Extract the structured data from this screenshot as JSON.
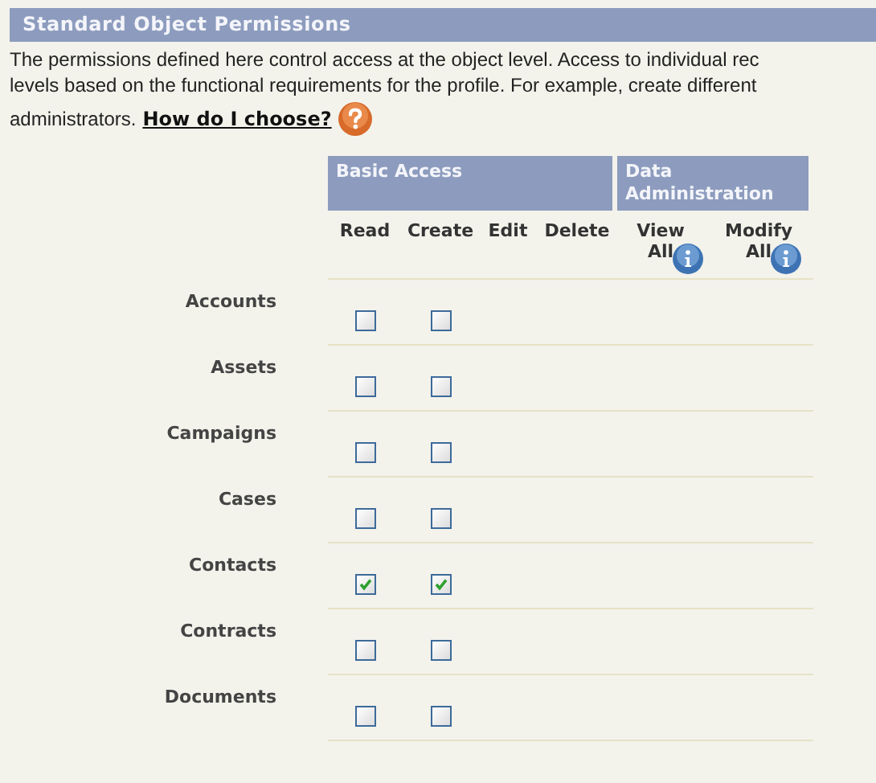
{
  "section": {
    "title": "Standard Object Permissions"
  },
  "intro": {
    "lines": [
      "The permissions defined here control access at the object level. Access to individual rec",
      "levels based on the functional requirements for the profile. For example, create different"
    ],
    "last_line": "administrators.",
    "link": "How do I choose?"
  },
  "groups": [
    {
      "label": "Basic Access",
      "columns": [
        {
          "label": "Read",
          "kind": "plain"
        },
        {
          "label": "Create",
          "kind": "plain"
        },
        {
          "label": "Edit",
          "kind": "plain"
        },
        {
          "label": "Delete",
          "kind": "plain"
        }
      ]
    },
    {
      "label": "Data Administration",
      "columns": [
        {
          "label": "View All",
          "kind": "info"
        },
        {
          "label": "Modify All",
          "kind": "info"
        }
      ]
    }
  ],
  "rows": [
    {
      "name": "Accounts",
      "checkboxes": [
        {
          "checked": false
        },
        {
          "checked": false
        }
      ]
    },
    {
      "name": "Assets",
      "checkboxes": [
        {
          "checked": false
        },
        {
          "checked": false
        }
      ]
    },
    {
      "name": "Campaigns",
      "checkboxes": [
        {
          "checked": false
        },
        {
          "checked": false
        }
      ]
    },
    {
      "name": "Cases",
      "checkboxes": [
        {
          "checked": false
        },
        {
          "checked": false
        }
      ]
    },
    {
      "name": "Contacts",
      "checkboxes": [
        {
          "checked": true
        },
        {
          "checked": true
        }
      ]
    },
    {
      "name": "Contracts",
      "checkboxes": [
        {
          "checked": false
        },
        {
          "checked": false
        }
      ]
    },
    {
      "name": "Documents",
      "checkboxes": [
        {
          "checked": false
        },
        {
          "checked": false
        }
      ]
    }
  ]
}
